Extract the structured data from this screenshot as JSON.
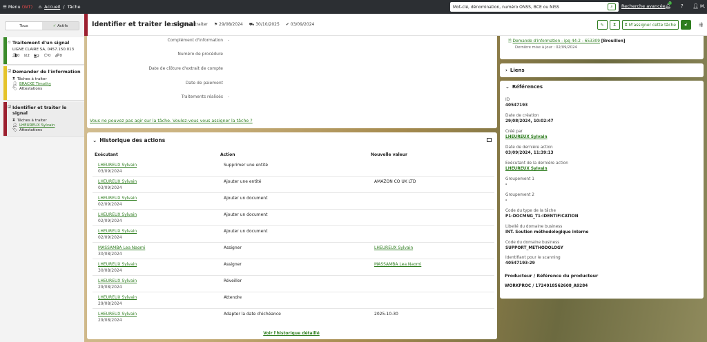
{
  "topbar": {
    "menu_label": "Menu",
    "env_label": "(WT)",
    "breadcrumb_home": "Accueil",
    "breadcrumb_sep": "/",
    "breadcrumb_current": "Tâche",
    "search_placeholder": "Mot-clé, dénomination, numéro ONSS, BCE ou NISS",
    "advanced_search": "Recherche avancée",
    "notif_count": "7",
    "user_initials": "M."
  },
  "left": {
    "toggle_all": "Tous",
    "toggle_active": "Actifs",
    "items": [
      {
        "title": "Traitement d'un signal",
        "subtitle": "LIGNE CLAIRE SA, 0457.150.013",
        "counters": [
          "0",
          "2",
          "2",
          "0",
          "0"
        ],
        "color": "#3a8a2a"
      },
      {
        "title": "Demander de l'information",
        "status": "Tâches à traiter",
        "person": "BRACKE Timothy",
        "tag": "Attestations",
        "color": "#e5c32a"
      },
      {
        "title": "Identifier et traiter le signal",
        "status": "Tâches à traiter",
        "person": "LHEUREUX Sylvain",
        "tag": "Attestations",
        "color": "#9c1f2f"
      }
    ]
  },
  "header": {
    "title": "Identifier et traiter le signal",
    "status": "Tâches à traiter",
    "date1": "29/08/2024",
    "date2": "30/10/2025",
    "date3": "03/09/2024",
    "assign_label": "M'assigner cette tâche"
  },
  "details": {
    "fields": [
      {
        "label": "Complément d'information",
        "value": "-"
      },
      {
        "label": "Numéro de procédure",
        "value": ""
      },
      {
        "label": "Date de clôture d'extrait de compte",
        "value": ""
      },
      {
        "label": "Date de paiement",
        "value": ""
      },
      {
        "label": "Traitements réalisés",
        "value": "-"
      }
    ],
    "notice": "Vous ne pouvez pas agir sur la tâche. Voulez-vous vous assigner la tâche ?"
  },
  "history": {
    "title": "Historique des actions",
    "col_executant": "Exécutant",
    "col_action": "Action",
    "col_new": "Nouvelle valeur",
    "rows": [
      {
        "who": "LHEUREUX Sylvain",
        "date": "03/09/2024",
        "action": "Supprimer une entité",
        "value": ""
      },
      {
        "who": "LHEUREUX Sylvain",
        "date": "03/09/2024",
        "action": "Ajouter une entité",
        "value": "AMAZON CO UK LTD"
      },
      {
        "who": "LHEUREUX Sylvain",
        "date": "02/09/2024",
        "action": "Ajouter un document",
        "value": ""
      },
      {
        "who": "LHEUREUX Sylvain",
        "date": "02/09/2024",
        "action": "Ajouter un document",
        "value": ""
      },
      {
        "who": "LHEUREUX Sylvain",
        "date": "02/09/2024",
        "action": "Ajouter un document",
        "value": ""
      },
      {
        "who": "MASSAMBA Lea Naomi",
        "date": "30/08/2024",
        "action": "Assigner",
        "value": "LHEUREUX Sylvain"
      },
      {
        "who": "LHEUREUX Sylvain",
        "date": "30/08/2024",
        "action": "Assigner",
        "value": "MASSAMBA Lea Naomi"
      },
      {
        "who": "LHEUREUX Sylvain",
        "date": "29/08/2024",
        "action": "Réveiller",
        "value": ""
      },
      {
        "who": "LHEUREUX Sylvain",
        "date": "29/08/2024",
        "action": "Attendre",
        "value": ""
      },
      {
        "who": "LHEUREUX Sylvain",
        "date": "29/08/2024",
        "action": "Adapter la date d'échéance",
        "value": "2025-10-30"
      }
    ],
    "more_link": "Voir l'historique détaillé"
  },
  "documents": {
    "doc_link": "Demande d'information - ipg 44-2 - 653309",
    "doc_status": "[Brouillon]",
    "updated": "Dernière mise à jour : 02/09/2024"
  },
  "links_title": "Liens",
  "references": {
    "title": "Références",
    "items": [
      {
        "label": "ID",
        "value": "40547193",
        "link": false
      },
      {
        "label": "Date de création",
        "value": "29/08/2024, 10:02:47",
        "link": false
      },
      {
        "label": "Créé par",
        "value": "LHEUREUX Sylvain",
        "link": true
      },
      {
        "label": "Date de dernière action",
        "value": "03/09/2024, 11:39:13",
        "link": false
      },
      {
        "label": "Exécutant de la dernière action",
        "value": "LHEUREUX Sylvain",
        "link": true
      },
      {
        "label": "Groupement 1",
        "value": "-",
        "link": false
      },
      {
        "label": "Groupement 2",
        "value": "-",
        "link": false
      },
      {
        "label": "Code du type de la tâche",
        "value": "P1-DOCMNG_T1-IDENTIFICATION",
        "link": false
      },
      {
        "label": "Libellé du domaine business",
        "value": "INT. Soutien méthodologique interne",
        "link": false
      },
      {
        "label": "Code du domaine business",
        "value": "SUPPORT_METHODOLOGY",
        "link": false
      },
      {
        "label": "Identifiant pour le scanning",
        "value": "40547193-29",
        "link": false
      }
    ],
    "producer_title": "Producteur / Référence du producteur",
    "producer_value": "WORKPROC / 1724918562608_A9284"
  }
}
